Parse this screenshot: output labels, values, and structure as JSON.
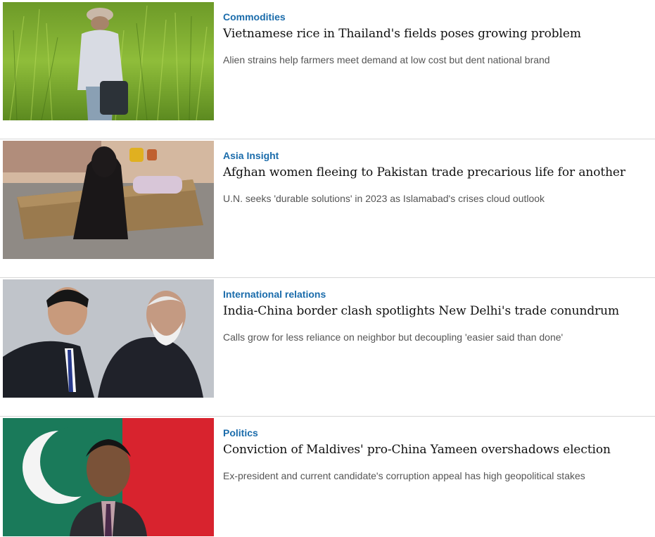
{
  "articles": [
    {
      "category": "Commodities",
      "headline": "Vietnamese rice in Thailand's fields poses growing problem",
      "summary": "Alien strains help farmers meet demand at low cost but dent national brand",
      "image": "farmer-in-rice-field"
    },
    {
      "category": "Asia Insight",
      "headline": "Afghan women fleeing to Pakistan trade precarious life for another",
      "summary": "U.N. seeks 'durable solutions' in 2023 as Islamabad's crises cloud outlook",
      "image": "woman-seated-on-cot"
    },
    {
      "category": "International relations",
      "headline": "India-China border clash spotlights New Delhi's trade conundrum",
      "summary": "Calls grow for less reliance on neighbor but decoupling 'easier said than done'",
      "image": "two-leaders-meeting"
    },
    {
      "category": "Politics",
      "headline": "Conviction of Maldives' pro-China Yameen overshadows election",
      "summary": "Ex-president and current candidate's corruption appeal has high geopolitical stakes",
      "image": "man-before-maldives-flag"
    }
  ],
  "colors": {
    "category": "#1b6cab",
    "headline": "#111111",
    "summary": "#555555",
    "divider": "#d6d6d6"
  }
}
